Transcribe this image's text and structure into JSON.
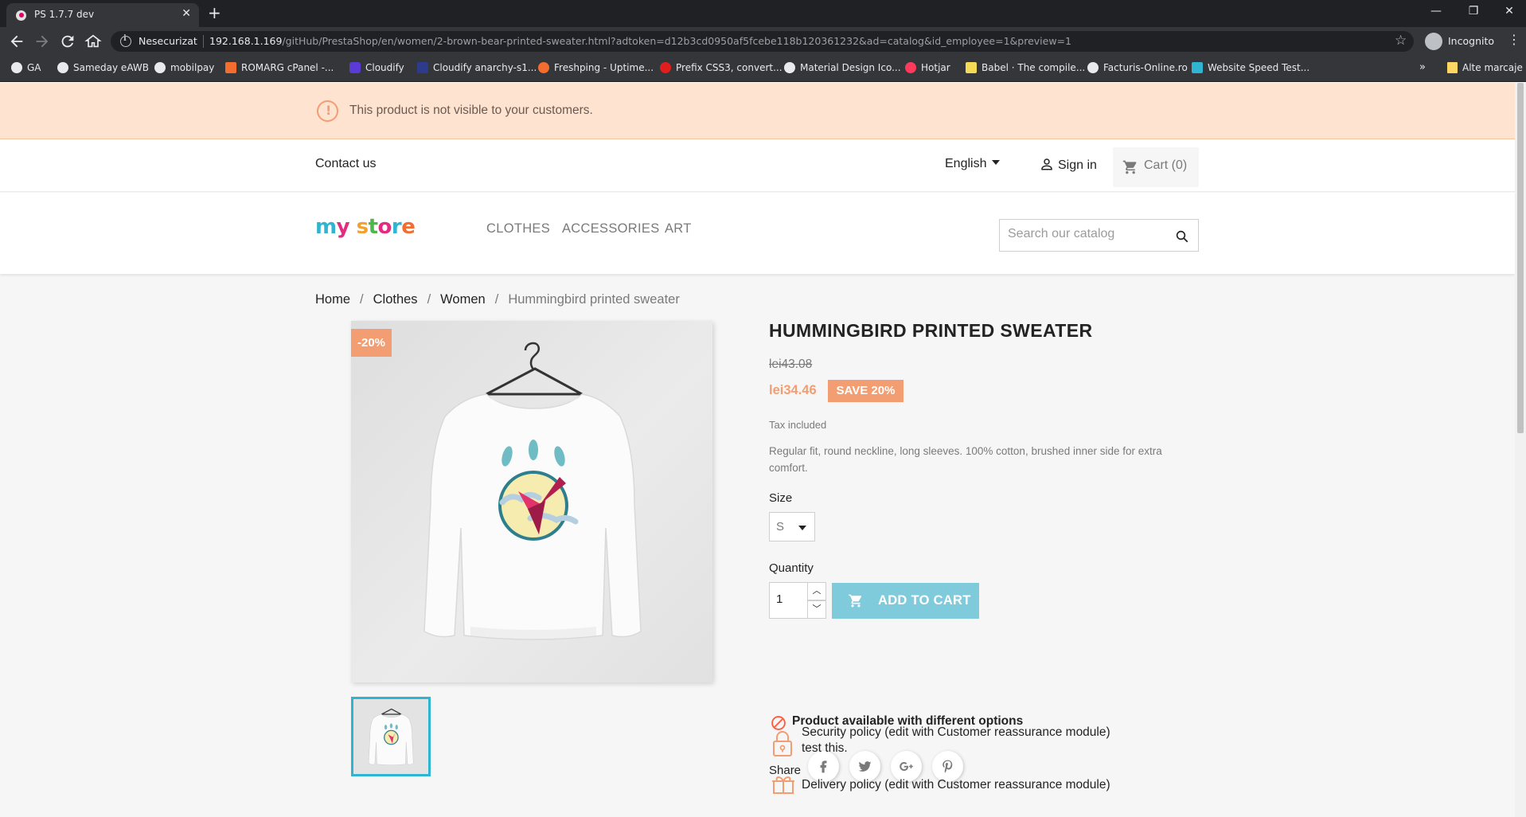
{
  "browser": {
    "tab_title": "PS 1.7.7 dev",
    "security_label": "Nesecurizat",
    "url_host": "192.168.1.169",
    "url_path": "/gitHub/PrestaShop/en/women/2-brown-bear-printed-sweater.html?adtoken=d12b3cd0950af5fcebe118b120361232&ad=catalog&id_employee=1&preview=1",
    "incognito_label": "Incognito",
    "bookmarks": [
      {
        "label": "GA",
        "color": "#e8eaed"
      },
      {
        "label": "Sameday eAWB",
        "color": "#e8eaed"
      },
      {
        "label": "mobilpay",
        "color": "#e8eaed"
      },
      {
        "label": "ROMARG cPanel -...",
        "color": "#f36d2e"
      },
      {
        "label": "Cloudify",
        "color": "#5b3bd6"
      },
      {
        "label": "Cloudify anarchy-s1...",
        "color": "#2d3b8c"
      },
      {
        "label": "Freshping - Uptime...",
        "color": "#f36d2e"
      },
      {
        "label": "Prefix CSS3, convert...",
        "color": "#e01e1e"
      },
      {
        "label": "Material Design Ico...",
        "color": "#e8eaed"
      },
      {
        "label": "Hotjar",
        "color": "#fd3a5c"
      },
      {
        "label": "Babel · The compile...",
        "color": "#f5da55"
      },
      {
        "label": "Facturis-Online.ro",
        "color": "#e8eaed"
      },
      {
        "label": "Website Speed Test...",
        "color": "#2fb5d2"
      }
    ],
    "bookmarks_other": "Alte marcaje"
  },
  "notice": {
    "text": "This product is not visible to your customers."
  },
  "header": {
    "contact": "Contact us",
    "language": "English",
    "signin": "Sign in",
    "cart": "Cart (0)",
    "menu": [
      "CLOTHES",
      "ACCESSORIES",
      "ART"
    ],
    "search_placeholder": "Search our catalog"
  },
  "breadcrumb": {
    "items": [
      "Home",
      "Clothes",
      "Women"
    ],
    "current": "Hummingbird printed sweater"
  },
  "product": {
    "discount_badge": "-20%",
    "title": "HUMMINGBIRD PRINTED SWEATER",
    "old_price": "lei43.08",
    "new_price": "lei34.46",
    "save_badge": "SAVE 20%",
    "tax": "Tax included",
    "description": "Regular fit, round neckline, long sleeves. 100% cotton, brushed inner side for extra comfort.",
    "size_label": "Size",
    "size_value": "S",
    "quantity_label": "Quantity",
    "quantity_value": "1",
    "add_to_cart": "ADD TO CART",
    "availability": "Product available with different options",
    "share_label": "Share",
    "social": [
      "facebook",
      "twitter",
      "google-plus",
      "pinterest"
    ],
    "reassurance": [
      {
        "line1": "Security policy (edit with Customer reassurance module)",
        "line2": "test this."
      },
      {
        "line1": "Delivery policy (edit with Customer reassurance module)",
        "line2": ""
      }
    ]
  },
  "colors": {
    "accent": "#2fb5d2",
    "discount": "#f39d72",
    "notice_bg": "#fde3d0",
    "add_to_cart_bg": "#7fcadb"
  }
}
